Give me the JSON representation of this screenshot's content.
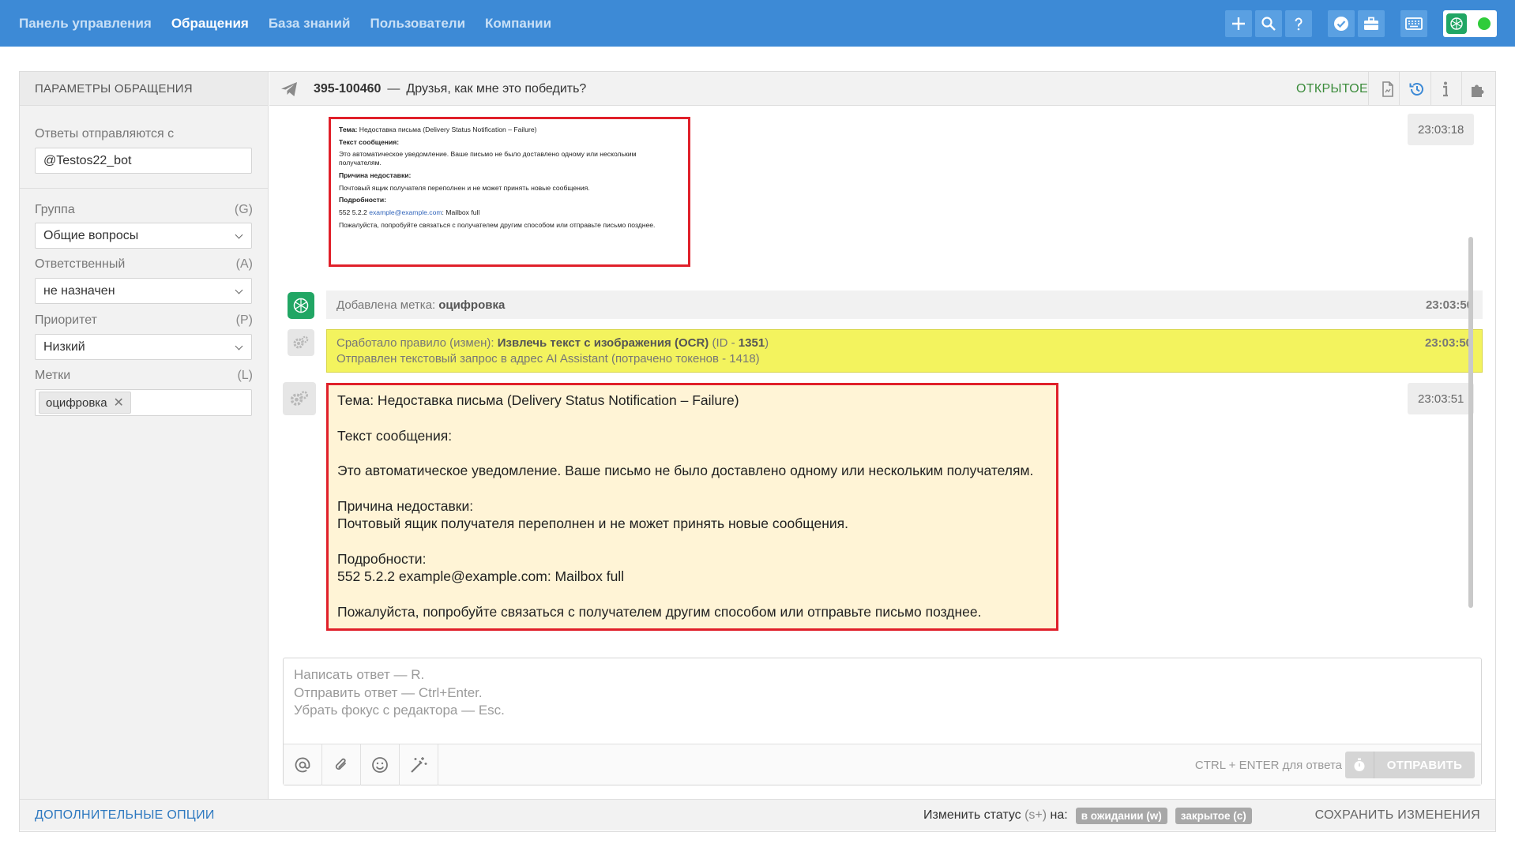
{
  "nav": {
    "items": [
      {
        "label": "Панель управления",
        "active": false
      },
      {
        "label": "Обращения",
        "active": true
      },
      {
        "label": "База знаний",
        "active": false
      },
      {
        "label": "Пользователи",
        "active": false
      },
      {
        "label": "Компании",
        "active": false
      }
    ],
    "toolbar_icons": [
      "plus-icon",
      "search-icon",
      "help-icon",
      "check-badge-icon",
      "briefcase-icon",
      "keyboard-icon"
    ],
    "user_online": true,
    "accent": "#3d8ad6"
  },
  "sidebar": {
    "title": "ПАРАМЕТРЫ ОБРАЩЕНИЯ",
    "reply_from_label": "Ответы отправляются с",
    "reply_from_value": "@Testos22_bot",
    "group_label": "Группа",
    "group_key": "(G)",
    "group_value": "Общие вопросы",
    "assignee_label": "Ответственный",
    "assignee_key": "(A)",
    "assignee_value": "не назначен",
    "priority_label": "Приоритет",
    "priority_key": "(P)",
    "priority_value": "Низкий",
    "tags_label": "Метки",
    "tags_key": "(L)",
    "tags": [
      "оцифровка"
    ]
  },
  "ticket": {
    "number": "395-100460",
    "dash": "—",
    "subject": "Друзья, как мне это победить?",
    "status": "ОТКРЫТОЕ",
    "status_color": "#3c8c3c"
  },
  "messages": {
    "image_message": {
      "time": "23:03:18",
      "subject_label": "Тема:",
      "subject_text": "Недоставка письма (Delivery Status Notification – Failure)",
      "text_label": "Текст сообщения:",
      "text_body": "Это автоматическое уведомление. Ваше письмо не было доставлено одному или нескольким получателям.",
      "reason_label": "Причина недоставки:",
      "reason_body": "Почтовый ящик получателя переполнен и не может принять новые сообщения.",
      "details_label": "Подробности:",
      "details_code": "552 5.2.2",
      "details_email": "example@example.com",
      "details_rest": ": Mailbox full",
      "closing": "Пожалуйста, попробуйте связаться с получателем другим способом или отправьте письмо позднее."
    },
    "tag_added": {
      "label": "Добавлена метка:",
      "tag": "оцифровка",
      "time": "23:03:50"
    },
    "rule_fired": {
      "prefix": "Сработало правило (измен):",
      "rule_name": "Извлечь текст с изображения (OCR)",
      "id_prefix": "(ID -",
      "id_value": "1351",
      "id_suffix": ")",
      "line2": "Отправлен текстовый запрос в адрес AI Assistant (потрачено токенов - 1418)",
      "time": "23:03:50",
      "highlight_color": "#f3f35e"
    },
    "ocr_result": {
      "time": "23:03:51",
      "line1": "Тема: Недоставка письма (Delivery Status Notification – Failure)",
      "line2": "Текст сообщения:",
      "line3": "Это автоматическое уведомление. Ваше письмо не было доставлено одному или нескольким получателям.",
      "line4": "Причина недоставки:",
      "line5": "Почтовый ящик получателя переполнен и не может принять новые сообщения.",
      "line6": "Подробности:",
      "line7": "552 5.2.2 example@example.com: Mailbox full",
      "line8": "Пожалуйста, попробуйте связаться с получателем другим способом или отправьте письмо позднее.",
      "background": "#fff4d6",
      "border_color": "#e0202a"
    }
  },
  "composer": {
    "placeholder_line1": "Написать ответ — R.",
    "placeholder_line2": "Отправить ответ — Ctrl+Enter.",
    "placeholder_line3": "Убрать фокус с редактора — Esc.",
    "tool_icons": [
      "at-icon",
      "paperclip-icon",
      "smile-icon",
      "magic-wand-icon"
    ],
    "send_hint": "CTRL + ENTER для ответа",
    "send_label": "ОТПРАВИТЬ"
  },
  "footer": {
    "more_options": "ДОПОЛНИТЕЛЬНЫЕ ОПЦИИ",
    "change_status_label": "Изменить статус",
    "change_status_key": "(s+)",
    "change_status_on": "на:",
    "status_pending": "в ожидании (w)",
    "status_closed": "закрытое (c)",
    "save_changes": "СОХРАНИТЬ ИЗМЕНЕНИЯ"
  }
}
